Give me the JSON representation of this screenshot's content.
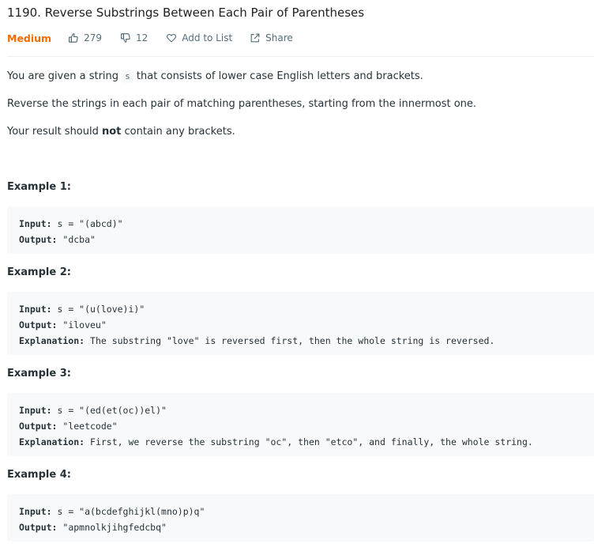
{
  "problem": {
    "title": "1190. Reverse Substrings Between Each Pair of Parentheses",
    "difficulty": "Medium",
    "likes": "279",
    "dislikes": "12",
    "add_to_list": "Add to List",
    "share": "Share"
  },
  "description": {
    "p1_before": "You are given a string ",
    "p1_code": "s",
    "p1_after": " that consists of lower case English letters and brackets.",
    "p2": "Reverse the strings in each pair of matching parentheses, starting from the innermost one.",
    "p3_before": "Your result should ",
    "p3_bold": "not",
    "p3_after": " contain any brackets."
  },
  "labels": {
    "input": "Input:",
    "output": "Output:",
    "explanation": "Explanation:"
  },
  "examples": [
    {
      "title": "Example 1:",
      "input": " s = \"(abcd)\"",
      "output": " \"dcba\""
    },
    {
      "title": "Example 2:",
      "input": " s = \"(u(love)i)\"",
      "output": " \"iloveu\"",
      "explanation": " The substring \"love\" is reversed first, then the whole string is reversed."
    },
    {
      "title": "Example 3:",
      "input": " s = \"(ed(et(oc))el)\"",
      "output": " \"leetcode\"",
      "explanation": " First, we reverse the substring \"oc\", then \"etco\", and finally, the whole string."
    },
    {
      "title": "Example 4:",
      "input": " s = \"a(bcdefghijkl(mno)p)q\"",
      "output": " \"apmnolkjihgfedcbq\""
    }
  ],
  "colors": {
    "difficulty_medium": "#ef6c00",
    "code_background": "#f7f9fa",
    "meta_text": "#546e7a"
  },
  "icons": {
    "likes": "thumbs-up-icon",
    "dislikes": "thumbs-down-icon",
    "add_to_list": "heart-icon",
    "share": "share-icon"
  }
}
